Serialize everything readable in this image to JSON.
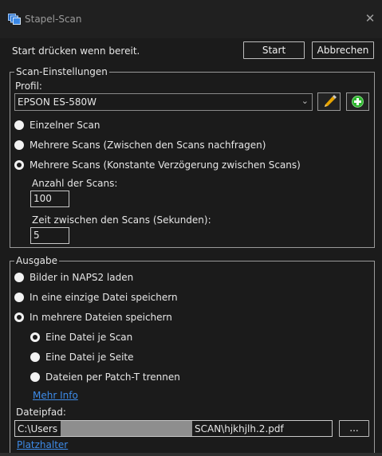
{
  "window": {
    "title": "Stapel-Scan",
    "close_glyph": "✕",
    "icon": "stacked-documents-icon"
  },
  "header": {
    "status_text": "Start drücken wenn bereit.",
    "start_label": "Start",
    "cancel_label": "Abbrechen"
  },
  "scan_settings": {
    "legend": "Scan-Einstellungen",
    "profile_label": "Profil:",
    "profile_value": "EPSON ES-580W",
    "edit_profile_icon": "pencil-icon",
    "add_profile_icon": "plus-icon",
    "options": [
      {
        "label": "Einzelner Scan",
        "selected": false
      },
      {
        "label": "Mehrere Scans (Zwischen den Scans nachfragen)",
        "selected": false
      },
      {
        "label": "Mehrere Scans (Konstante Verzögerung zwischen Scans)",
        "selected": true
      }
    ],
    "scan_count_label": "Anzahl der Scans:",
    "scan_count_value": "100",
    "delay_label": "Zeit zwischen den Scans (Sekunden):",
    "delay_value": "5"
  },
  "output": {
    "legend": "Ausgabe",
    "options": [
      {
        "label": "Bilder in NAPS2 laden",
        "selected": false
      },
      {
        "label": "In eine einzige Datei speichern",
        "selected": false
      },
      {
        "label": "In mehrere Dateien speichern",
        "selected": true
      }
    ],
    "split_options": [
      {
        "label": "Eine Datei je Scan",
        "selected": true
      },
      {
        "label": "Eine Datei je Seite",
        "selected": false
      },
      {
        "label": "Dateien per Patch-T trennen",
        "selected": false
      }
    ],
    "more_info_link": "Mehr Info",
    "filepath_label": "Dateipfad:",
    "filepath_prefix": "C:\\Users",
    "filepath_suffix": "SCAN\\hjkhjlh.2.pdf",
    "browse_label": "...",
    "placeholders_link": "Platzhalter"
  },
  "colors": {
    "background": "#1b1b1b",
    "link": "#3d8be8",
    "pencil": "#e8a400",
    "plus": "#2db52d"
  }
}
